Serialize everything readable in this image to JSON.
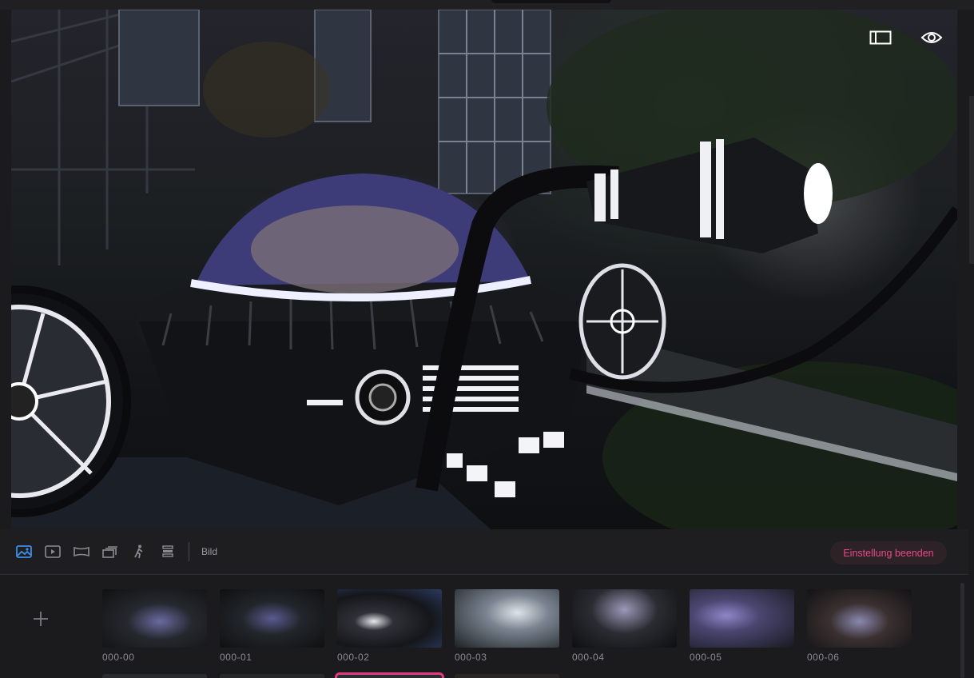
{
  "viewport": {
    "toggle_panel_icon": "panel-layout-icon",
    "preview_icon": "eye-icon"
  },
  "toolbar": {
    "tools": [
      {
        "icon": "image-icon",
        "active": true
      },
      {
        "icon": "video-icon",
        "active": false
      },
      {
        "icon": "panorama-icon",
        "active": false
      },
      {
        "icon": "turntable-icon",
        "active": false
      },
      {
        "icon": "walkthrough-icon",
        "active": false
      },
      {
        "icon": "layers-icon",
        "active": false
      }
    ],
    "mode_label": "Bild",
    "end_button": "Einstellung beenden",
    "accent_color": "#e64a86",
    "active_tool_color": "#3d8ee8"
  },
  "filmstrip": {
    "add_icon": "plus-icon",
    "items": [
      {
        "label": "000-00"
      },
      {
        "label": "000-01"
      },
      {
        "label": "000-02"
      },
      {
        "label": "000-03"
      },
      {
        "label": "000-04"
      },
      {
        "label": "000-05"
      },
      {
        "label": "000-06"
      }
    ],
    "selection_color": "#e23a83"
  }
}
